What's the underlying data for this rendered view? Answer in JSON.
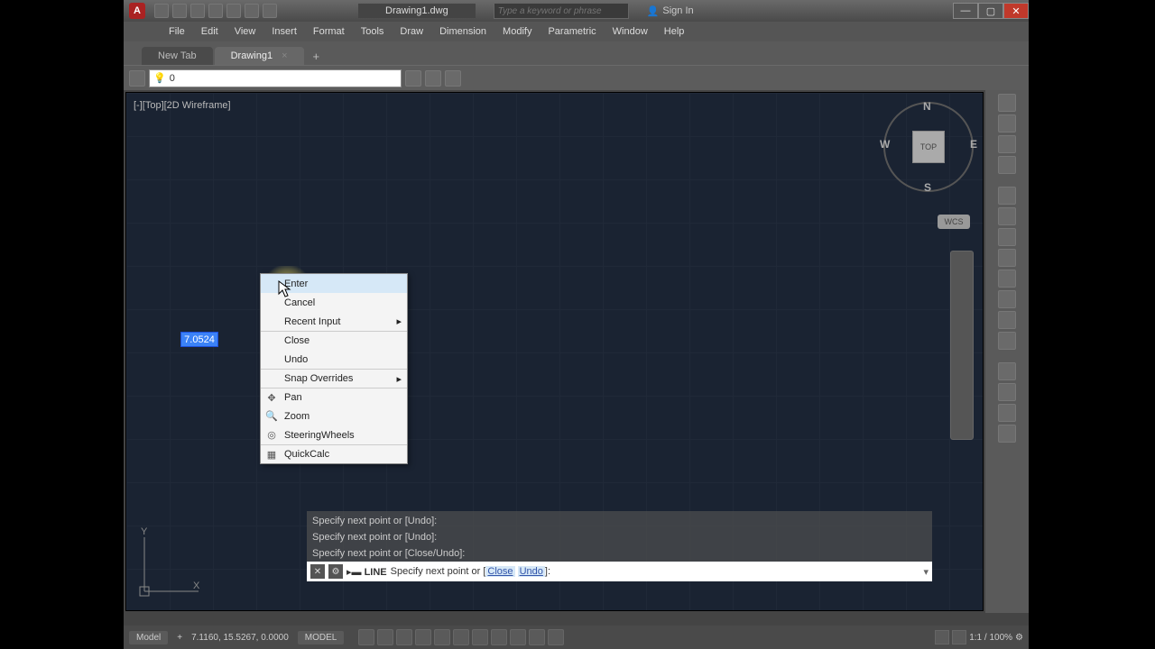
{
  "titlebar": {
    "title": "Drawing1.dwg",
    "search_placeholder": "Type a keyword or phrase",
    "signin": "Sign In"
  },
  "menubar": [
    "File",
    "Edit",
    "View",
    "Insert",
    "Format",
    "Tools",
    "Draw",
    "Dimension",
    "Modify",
    "Parametric",
    "Window",
    "Help"
  ],
  "tabs": {
    "newtab": "New Tab",
    "active": "Drawing1"
  },
  "layer": {
    "current": "0"
  },
  "viewport": {
    "label": "[-][Top][2D Wireframe]"
  },
  "navcube": {
    "n": "N",
    "s": "S",
    "e": "E",
    "w": "W",
    "face": "TOP",
    "wcs": "WCS"
  },
  "dyninput": "7.0524",
  "context_menu": {
    "enter": "Enter",
    "cancel": "Cancel",
    "recent": "Recent Input",
    "close": "Close",
    "undo": "Undo",
    "snap": "Snap Overrides",
    "pan": "Pan",
    "zoom": "Zoom",
    "wheels": "SteeringWheels",
    "quickcalc": "QuickCalc"
  },
  "ucs": {
    "x": "X",
    "y": "Y"
  },
  "cmd_history": {
    "l1": "Specify next point or [Undo]:",
    "l2": "Specify next point or [Undo]:",
    "l3": "Specify next point or [Close/Undo]:"
  },
  "cmdline": {
    "cmd": "LINE",
    "prompt": "Specify next point or [",
    "opt1": "Close",
    "opt2": "Undo",
    "tail": "]:"
  },
  "status": {
    "model_tab": "Model",
    "coords": "7.1160, 15.5267, 0.0000",
    "space": "MODEL",
    "scale": "1:1 / 100%"
  }
}
